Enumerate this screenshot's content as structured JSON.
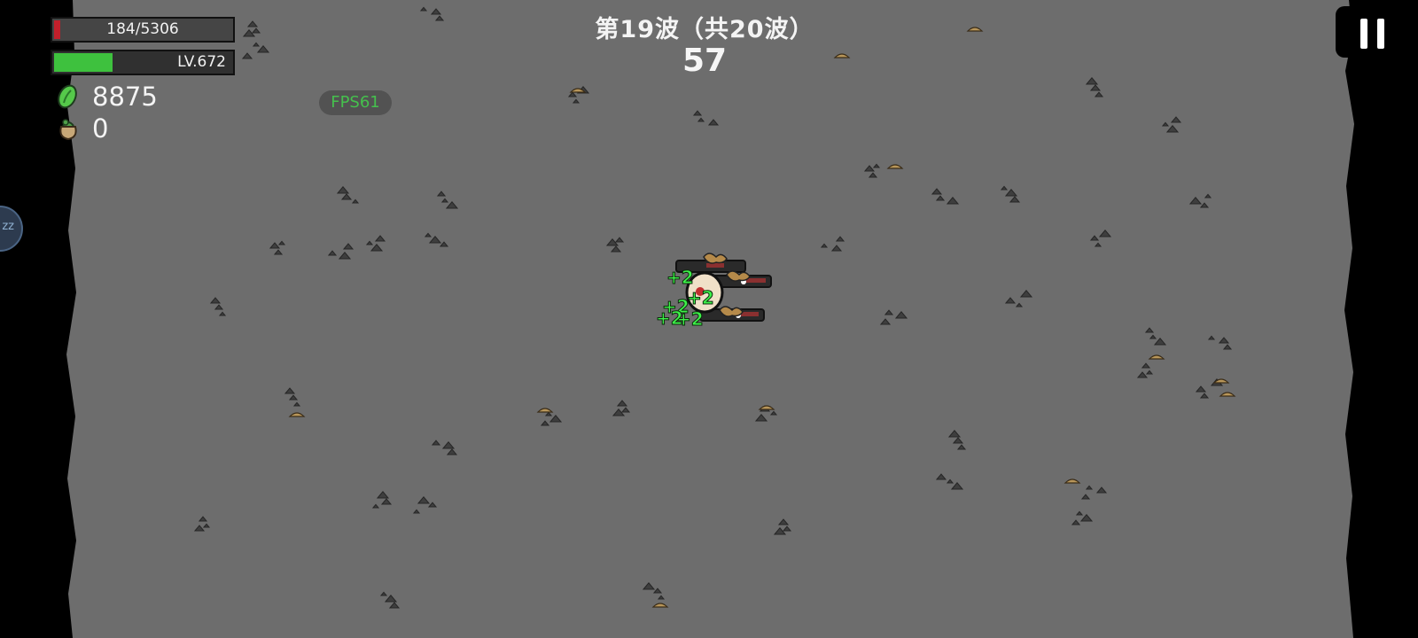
{
  "hud": {
    "hp": {
      "text": "184/5306",
      "fraction": 0.035
    },
    "level": {
      "text": "LV.672",
      "fraction": 0.33
    },
    "materials": 8875,
    "bag_count": 0,
    "fps": "FPS61"
  },
  "wave": {
    "title": "第19波（共20波）",
    "timer": 57
  },
  "player_popups": [
    "+2",
    "+2",
    "+2",
    "+2",
    "+2"
  ],
  "side_bubble_text": "zz",
  "colors": {
    "ground": "#6b6b6b",
    "border": "#0a0a0a",
    "heal_text": "#3ef24a",
    "hp": "#c21f2b",
    "xp": "#3ec13e",
    "material": "#55c94a",
    "fps_text": "#45c04d"
  },
  "icons": {
    "pause": "pause-icon",
    "materials": "green-material-icon",
    "bag": "loot-bag-icon"
  }
}
